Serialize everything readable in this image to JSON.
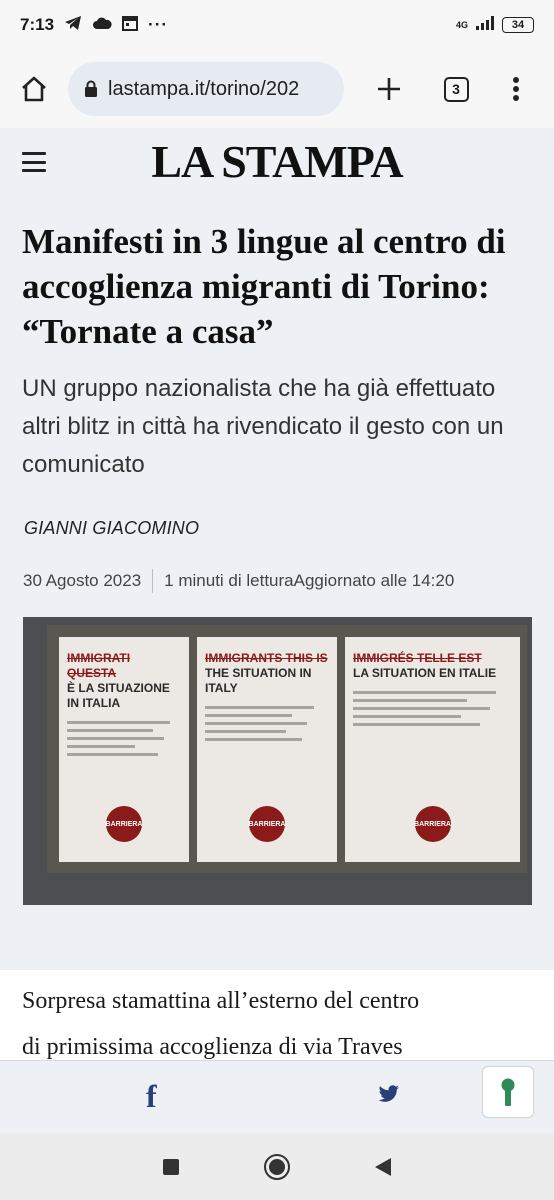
{
  "status_bar": {
    "time": "7:13",
    "network": "4G",
    "battery": "34"
  },
  "browser": {
    "url": "lastampa.it/torino/202",
    "tab_count": "3"
  },
  "site": {
    "logo": "LA STAMPA"
  },
  "article": {
    "headline": "Manifesti in 3 lingue al centro di accoglienza migranti di Torino: “Tornate a casa”",
    "subheadline": "UN gruppo nazionalista che ha già effettuato altri blitz in città ha rivendicato il gesto con un comunicato",
    "author": "GIANNI GIACOMINO",
    "date": "30 Agosto 2023",
    "reading_time": "1 minuti di lettura",
    "updated": "Aggiornato alle 14:20",
    "body_line1": "Sorpresa stamattina all’esterno del centro",
    "body_line2": "di primissima accoglienza di via Traves"
  },
  "photo": {
    "posters": [
      {
        "head1": "Immigrati Questa",
        "head2": "è la situazione in Italia",
        "logo": "BARRIERA"
      },
      {
        "head1": "Immigrants This is",
        "head2": "the situation in Italy",
        "logo": "BARRIERA"
      },
      {
        "head1": "Immigrés Telle est",
        "head2": "la situation en Italie",
        "logo": "BARRIERA"
      }
    ]
  },
  "icons": {
    "home": "home-icon",
    "lock": "lock-icon",
    "facebook": "facebook-icon",
    "twitter": "twitter-icon",
    "keyhole": "keyhole-icon"
  },
  "colors": {
    "page_bg": "#edf1f6",
    "facebook": "#2a3f7a",
    "twitter": "#2a3f7a",
    "keyhole": "#2e8b57"
  }
}
